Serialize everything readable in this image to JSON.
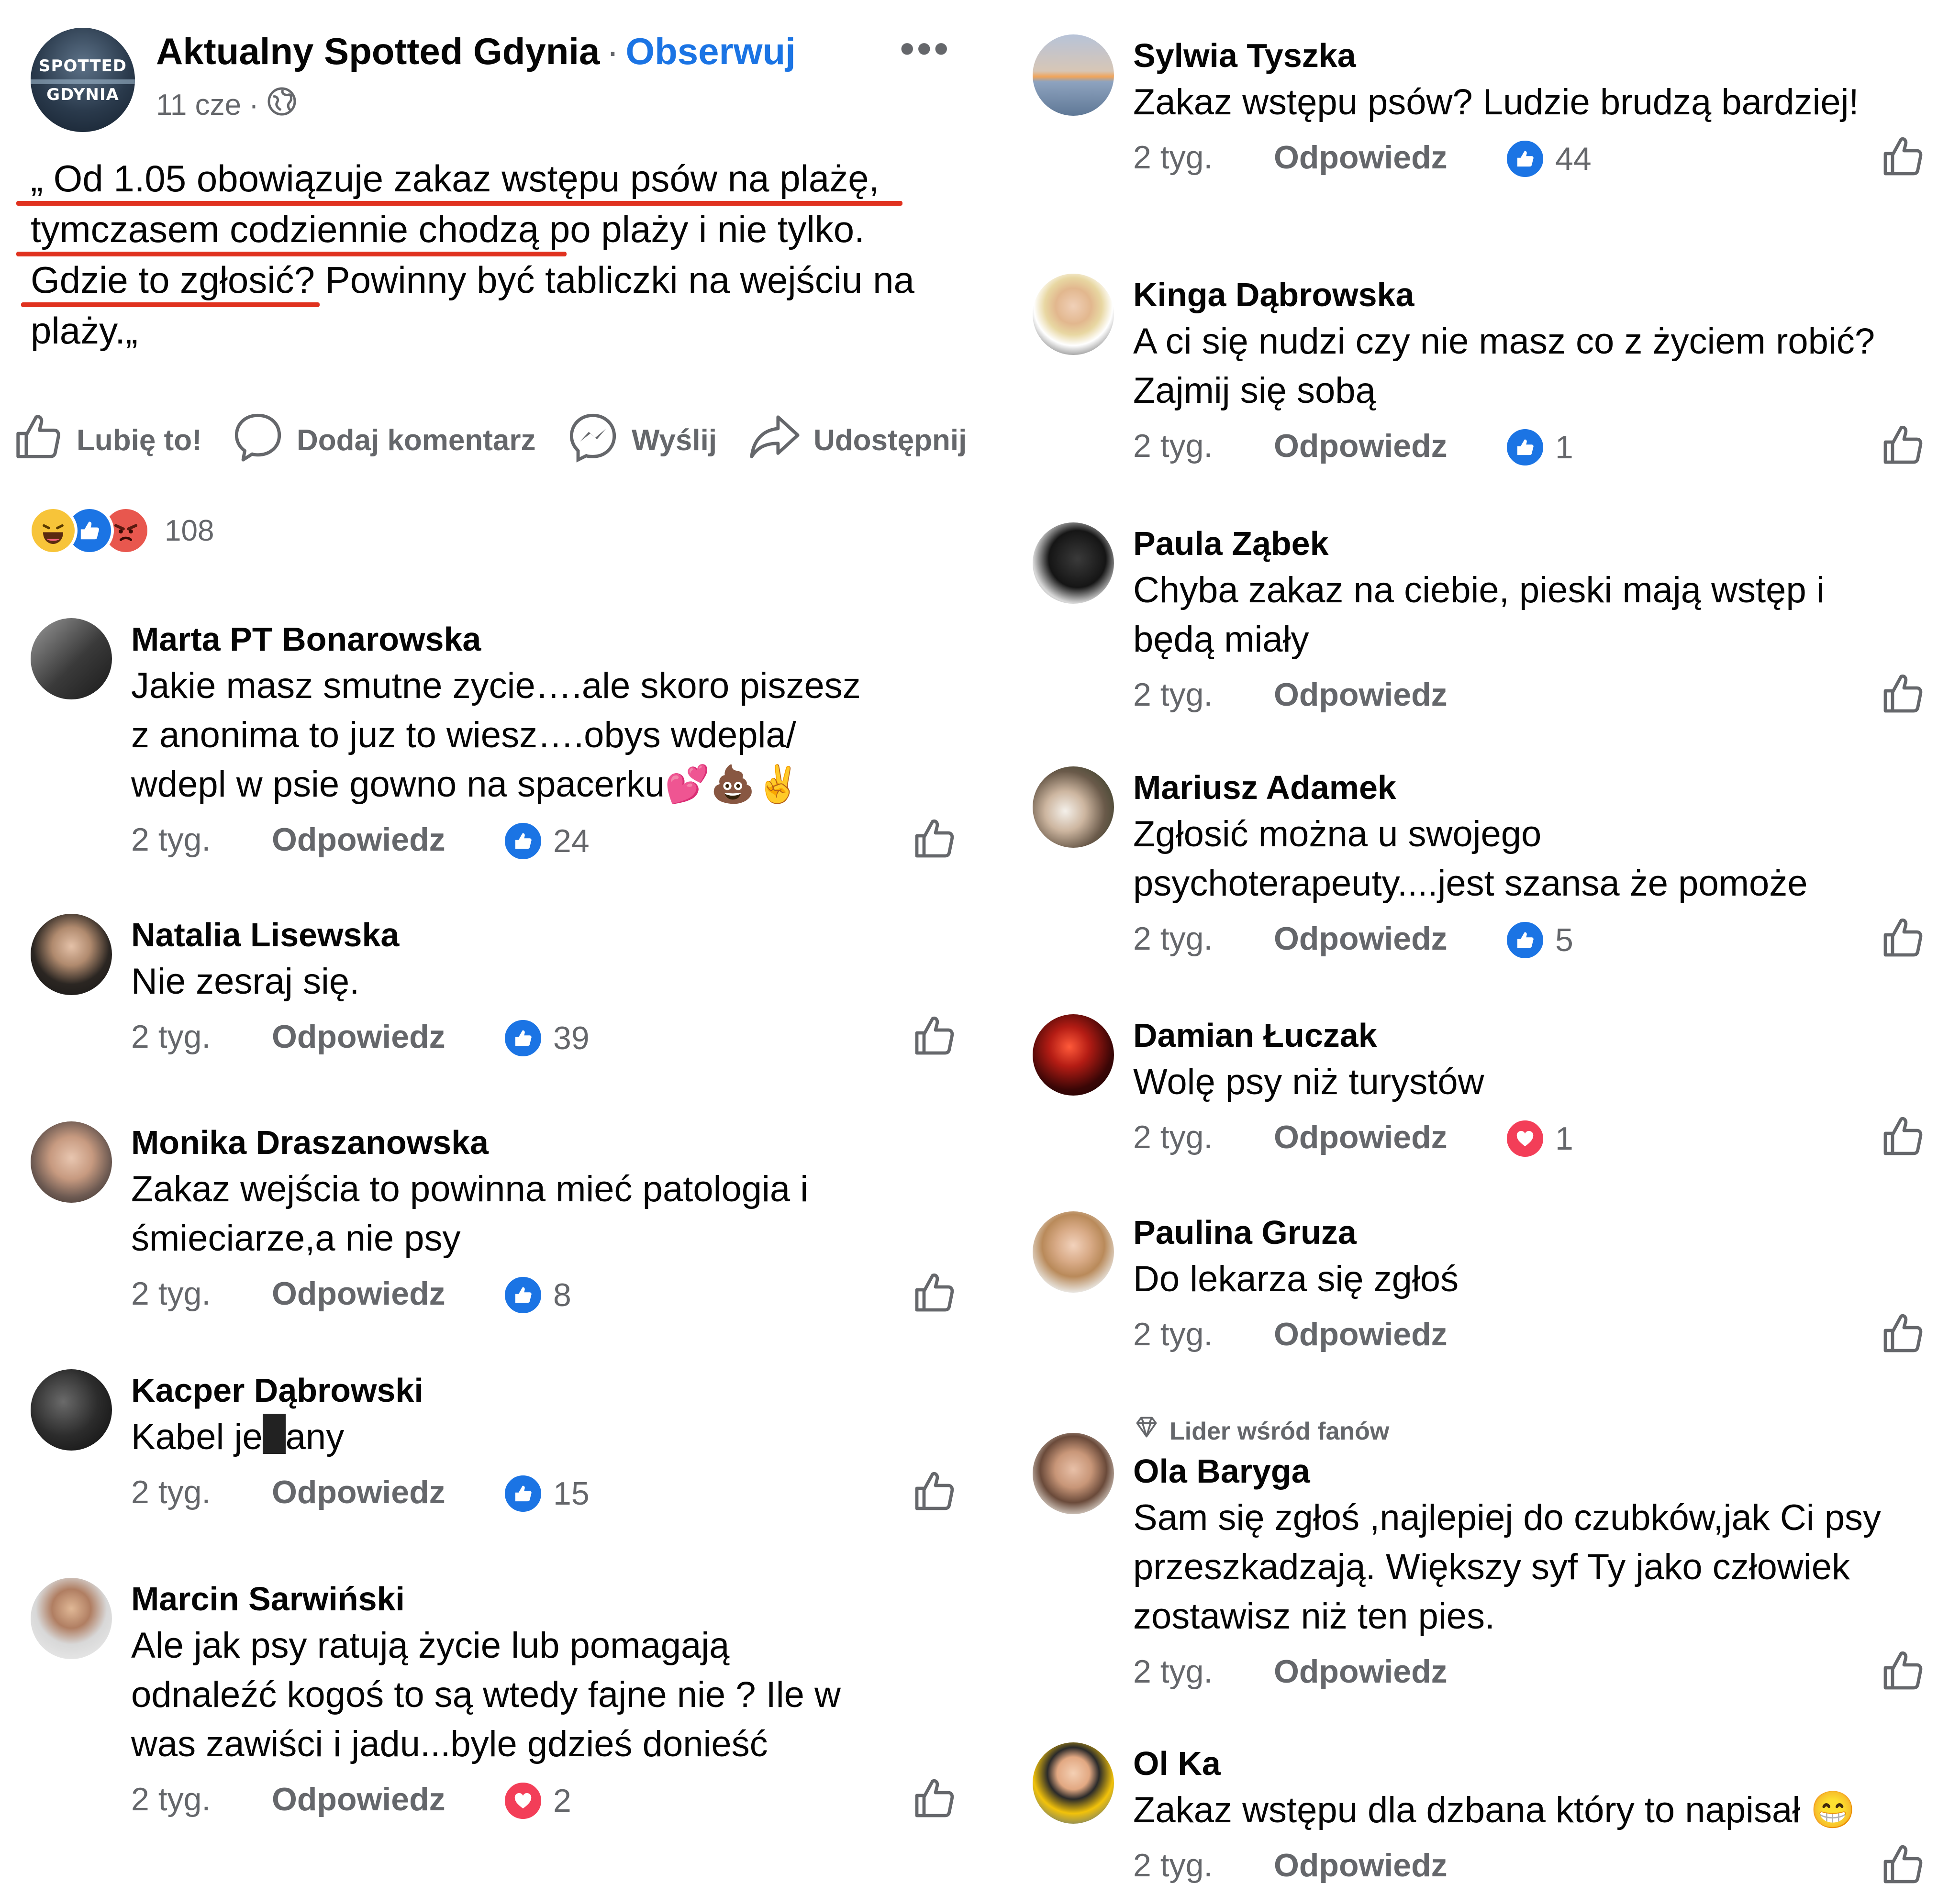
{
  "post": {
    "page_name": "Aktualny Spotted Gdynia",
    "separator": "·",
    "follow_label": "Obserwuj",
    "more_label": "•••",
    "date": "11 cze",
    "avatar_text_1": "SPOTTED",
    "avatar_text_2": "GDYNIA",
    "text_lines": [
      "„ Od 1.05 obowiązuje zakaz wstępu psów na plażę,",
      "tymczasem codziennie chodzą po plaży i nie tylko.",
      "Gdzie to zgłosić? Powinny być tabliczki na wejściu na",
      "plaży.„"
    ]
  },
  "actions": {
    "like": "Lubię to!",
    "comment": "Dodaj komentarz",
    "send": "Wyślij",
    "share": "Udostępnij"
  },
  "reactions": {
    "count": "108",
    "icons": [
      "haha-icon",
      "like-icon",
      "angry-icon"
    ]
  },
  "colors": {
    "accent": "#1b74e4",
    "secondary_text": "#65676b",
    "underline": "#e0321f",
    "love": "#f33e58"
  },
  "reply_label": "Odpowiedz",
  "comments_left": [
    {
      "name": "Marta PT Bonarowska",
      "lines": [
        "Jakie masz smutne zycie….ale skoro piszesz",
        "z anonima to juz to wiesz….obys wdepla/",
        "wdepl w psie gowno na spacerku💕💩✌️"
      ],
      "time": "2 tyg.",
      "reaction": "like",
      "count": "24"
    },
    {
      "name": "Natalia Lisewska",
      "lines": [
        "Nie zesraj się."
      ],
      "time": "2 tyg.",
      "reaction": "like",
      "count": "39"
    },
    {
      "name": "Monika Draszanowska",
      "lines": [
        "Zakaz wejścia to powinna mieć patologia i",
        "śmieciarze,a nie psy"
      ],
      "time": "2 tyg.",
      "reaction": "like",
      "count": "8"
    },
    {
      "name": "Kacper Dąbrowski",
      "text_a": "Kabel je",
      "text_b": "any",
      "time": "2 tyg.",
      "reaction": "like",
      "count": "15"
    },
    {
      "name": "Marcin Sarwiński",
      "lines": [
        "Ale jak psy ratują życie lub pomagają",
        "odnaleźć kogoś to są wtedy fajne nie ? Ile w",
        "was zawiści i jadu...byle gdzieś donieść"
      ],
      "time": "2 tyg.",
      "reaction": "love",
      "count": "2"
    }
  ],
  "comments_right": [
    {
      "name": "Sylwia Tyszka",
      "lines": [
        "Zakaz wstępu psów? Ludzie brudzą bardziej!"
      ],
      "time": "2 tyg.",
      "reaction": "like",
      "count": "44"
    },
    {
      "name": "Kinga Dąbrowska",
      "lines": [
        "A ci się nudzi czy nie masz co z życiem robić?",
        "Zajmij się sobą"
      ],
      "time": "2 tyg.",
      "reaction": "like",
      "count": "1"
    },
    {
      "name": "Paula Ząbek",
      "lines": [
        "Chyba zakaz na ciebie, pieski mają wstęp i",
        "będą miały"
      ],
      "time": "2 tyg."
    },
    {
      "name": "Mariusz Adamek",
      "lines": [
        "Zgłosić  można u swojego",
        "psychoterapeuty....jest szansa że pomoże"
      ],
      "time": "2 tyg.",
      "reaction": "like",
      "count": "5"
    },
    {
      "name": "Damian Łuczak",
      "lines": [
        "Wolę psy niż turystów"
      ],
      "time": "2 tyg.",
      "reaction": "love",
      "count": "1"
    },
    {
      "name": "Paulina Gruza",
      "lines": [
        "Do lekarza się zgłoś"
      ],
      "time": "2 tyg."
    },
    {
      "name": "Ola Baryga",
      "badge": "Lider wśród fanów",
      "lines": [
        "Sam się zgłoś ,najlepiej do czubków,jak Ci psy",
        "przeszkadzają. Większy syf Ty jako człowiek",
        "zostawisz niż ten pies."
      ],
      "time": "2 tyg."
    },
    {
      "name": "Ol Ka",
      "lines": [
        "Zakaz wstępu dla dzbana który to napisał 😁"
      ],
      "time": "2 tyg."
    }
  ]
}
